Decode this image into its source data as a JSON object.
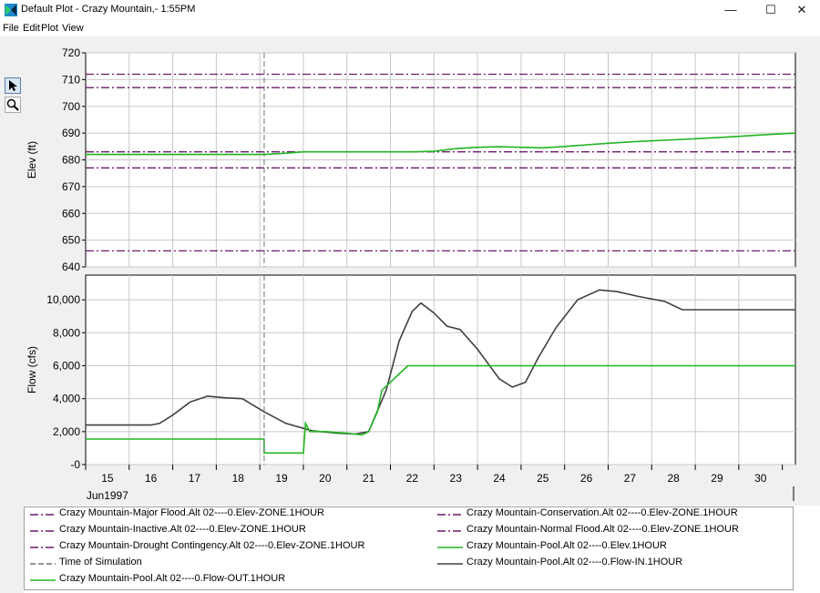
{
  "window": {
    "title": "Default Plot - Crazy Mountain,- 1:55PM",
    "min_glyph": "—",
    "max_glyph": "☐",
    "close_glyph": "✕"
  },
  "menu": {
    "file": "File",
    "edit": "Edit",
    "plot": "Plot",
    "view": "View"
  },
  "toolbar": {
    "icons": [
      "select-arrow-icon",
      "zoom-magnifier-icon"
    ]
  },
  "colors": {
    "zone": "#6a1b6a",
    "pool_elev": "#22b522",
    "flow_out": "#22b522",
    "flow_in": "#404040",
    "sim_line": "#707070"
  },
  "chart_data": [
    {
      "type": "line",
      "ylabel": "Elev (ft)",
      "ylim": [
        640,
        720
      ],
      "yticks": [
        "720",
        "710",
        "700",
        "690",
        "680",
        "670",
        "660",
        "650",
        "640"
      ],
      "grid": true,
      "x_unit": "day of Jun 1997 (0 = Jun 15 00:00)",
      "xlim": [
        0,
        16.3
      ],
      "horizontal_lines": [
        {
          "name": "Crazy Mountain-Major Flood.Alt 02----0.Elev-ZONE.1HOUR",
          "y": 712
        },
        {
          "name": "Crazy Mountain-Normal Flood.Alt 02----0.Elev-ZONE.1HOUR",
          "y": 707
        },
        {
          "name": "Crazy Mountain-Conservation.Alt 02----0.Elev-ZONE.1HOUR",
          "y": 683
        },
        {
          "name": "Crazy Mountain-Drought Contingency.Alt 02----0.Elev-ZONE.1HOUR",
          "y": 677
        },
        {
          "name": "Crazy Mountain-Inactive.Alt 02----0.Elev-ZONE.1HOUR",
          "y": 646
        }
      ],
      "series": [
        {
          "name": "Crazy Mountain-Pool.Alt 02----0.Elev.1HOUR",
          "x": [
            0,
            4.1,
            4.6,
            5,
            6,
            7,
            7.5,
            8,
            8.5,
            9,
            9.5,
            10,
            10.5,
            11,
            11.5,
            12,
            12.5,
            13,
            13.5,
            14,
            14.5,
            15,
            15.5,
            16.3
          ],
          "values": [
            682,
            682,
            682.5,
            683,
            683,
            683,
            683,
            683.2,
            684.2,
            684.7,
            684.9,
            684.7,
            684.5,
            685,
            685.6,
            686.2,
            686.7,
            687.1,
            687.5,
            687.9,
            688.3,
            688.8,
            689.3,
            690
          ]
        }
      ]
    },
    {
      "type": "line",
      "ylabel": "Flow (cfs)",
      "ylim": [
        0,
        11500
      ],
      "yticks": [
        "10,000",
        "8,000",
        "6,000",
        "4,000",
        "2,000",
        "-0"
      ],
      "grid": true,
      "x_unit": "day of Jun 1997 (0 = Jun 15 00:00)",
      "xlim": [
        0,
        16.3
      ],
      "xticks": [
        "15",
        "16",
        "17",
        "18",
        "19",
        "20",
        "21",
        "22",
        "23",
        "24",
        "25",
        "26",
        "27",
        "28",
        "29",
        "30"
      ],
      "xlabel_secondary": "Jun1997",
      "series": [
        {
          "name": "Crazy Mountain-Pool.Alt 02----0.Flow-IN.1HOUR",
          "x": [
            0,
            1.5,
            1.7,
            2,
            2.4,
            2.8,
            3.2,
            3.6,
            4.1,
            4.6,
            5.2,
            5.8,
            6.2,
            6.5,
            6.9,
            7.2,
            7.5,
            7.7,
            8,
            8.3,
            8.6,
            9,
            9.5,
            9.8,
            10.1,
            10.4,
            10.8,
            11.3,
            11.8,
            12.2,
            12.7,
            13.3,
            13.7,
            14,
            15,
            16.3
          ],
          "values": [
            2400,
            2400,
            2500,
            3000,
            3800,
            4150,
            4050,
            4000,
            3200,
            2500,
            2050,
            1900,
            1850,
            2000,
            4500,
            7500,
            9300,
            9800,
            9200,
            8400,
            8200,
            7000,
            5200,
            4700,
            5000,
            6500,
            8300,
            10000,
            10600,
            10500,
            10200,
            9900,
            9400,
            9400,
            9400,
            9400
          ]
        },
        {
          "name": "Crazy Mountain-Pool.Alt 02----0.Flow-OUT.1HOUR",
          "x": [
            0,
            4.1,
            4.1,
            5,
            5,
            5.05,
            5.15,
            5.5,
            6,
            6.35,
            6.5,
            6.7,
            6.8,
            7,
            7.2,
            7.4,
            7.5,
            16.3
          ],
          "values": [
            1550,
            1550,
            700,
            700,
            700,
            2500,
            2000,
            2000,
            1900,
            1800,
            2000,
            3200,
            4500,
            5000,
            5500,
            6000,
            6000,
            6000
          ]
        }
      ],
      "annotation_line": {
        "name": "Time of Simulation",
        "x": 4.1
      }
    }
  ],
  "legend": {
    "items": [
      {
        "label": "Crazy Mountain-Major Flood.Alt 02----0.Elev-ZONE.1HOUR",
        "style": "dashdot",
        "color": "#6a1b6a"
      },
      {
        "label": "Crazy Mountain-Conservation.Alt 02----0.Elev-ZONE.1HOUR",
        "style": "dashdot",
        "color": "#6a1b6a"
      },
      {
        "label": "Crazy Mountain-Inactive.Alt 02----0.Elev-ZONE.1HOUR",
        "style": "dashdot",
        "color": "#6a1b6a"
      },
      {
        "label": "Crazy Mountain-Normal Flood.Alt 02----0.Elev-ZONE.1HOUR",
        "style": "dashdot",
        "color": "#6a1b6a"
      },
      {
        "label": "Crazy Mountain-Drought Contingency.Alt 02----0.Elev-ZONE.1HOUR",
        "style": "dashdot",
        "color": "#6a1b6a"
      },
      {
        "label": "Crazy Mountain-Pool.Alt 02----0.Elev.1HOUR",
        "style": "solid",
        "color": "#22b522"
      },
      {
        "label": "Time of Simulation",
        "style": "dashed",
        "color": "#707070"
      },
      {
        "label": "Crazy Mountain-Pool.Alt 02----0.Flow-IN.1HOUR",
        "style": "solid",
        "color": "#404040"
      },
      {
        "label": "Crazy Mountain-Pool.Alt 02----0.Flow-OUT.1HOUR",
        "style": "solid",
        "color": "#22b522"
      }
    ]
  }
}
